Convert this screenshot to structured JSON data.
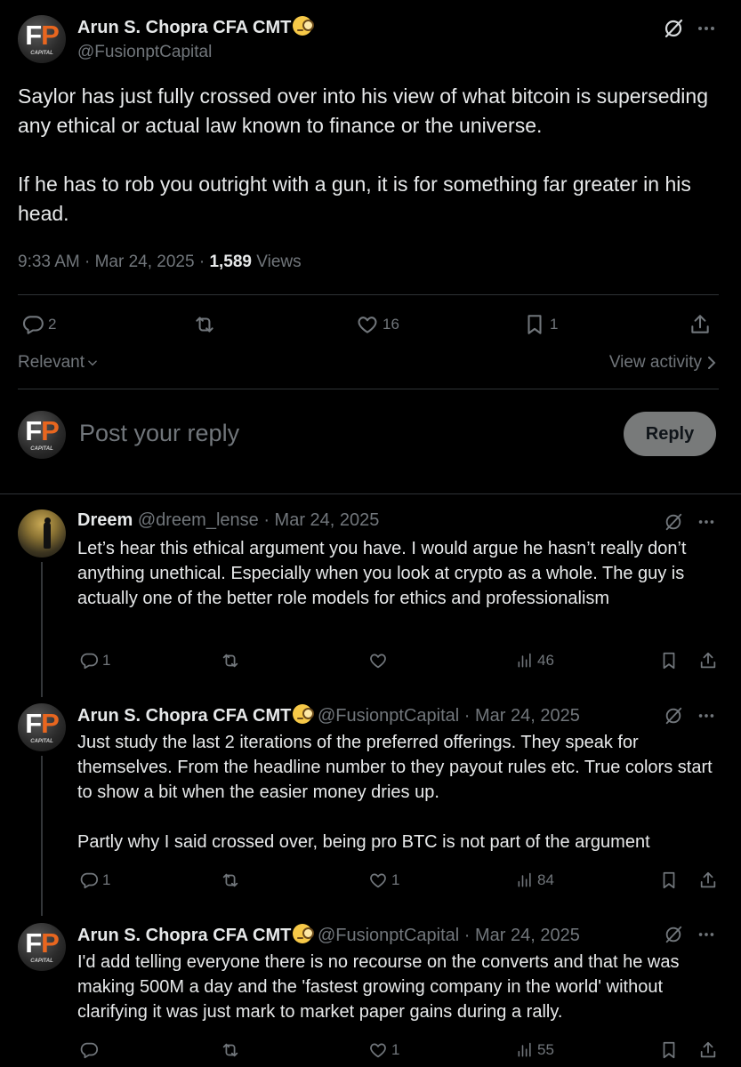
{
  "main_tweet": {
    "author_name": "Arun S. Chopra CFA CMT",
    "author_handle": "@FusionptCapital",
    "avatar_letters_f": "F",
    "avatar_letters_p": "P",
    "avatar_caption": "CAPITAL",
    "text": [
      "Saylor has just fully crossed over into his view of what bitcoin is superseding any ethical or actual law known to finance or the universe.",
      "If he has to rob you outright with a gun, it is for something far greater in his head."
    ],
    "time": "9:33 AM · Mar 24, 2025 · ",
    "views_count": "1,589",
    "views_label": " Views",
    "actions": {
      "replies": "2",
      "reposts": "",
      "likes": "16",
      "bookmarks": "1"
    }
  },
  "sort": {
    "relevant_label": "Relevant",
    "view_activity_label": "View activity"
  },
  "composer": {
    "placeholder": "Post your reply",
    "reply_button": "Reply"
  },
  "replies": [
    {
      "author_name": "Dreem",
      "meta": "@dreem_lense · Mar 24, 2025",
      "text": [
        "Let’s hear this ethical argument you have. I would argue he hasn’t really don’t anything unethical. Especially when you look at crypto as a whole. The guy is actually one of the better role models for ethics and professionalism"
      ],
      "replies": "1",
      "likes": "",
      "views": "46"
    },
    {
      "author_name": "Arun S. Chopra CFA CMT",
      "meta": "@FusionptCapital · Mar 24, 2025",
      "text": [
        "Just study the last 2 iterations of the preferred offerings. They speak for themselves. From the headline number to they payout rules etc. True colors start to show a bit when the easier money dries up.",
        "Partly why I said crossed over, being pro BTC is not part of the argument"
      ],
      "replies": "1",
      "likes": "1",
      "views": "84"
    },
    {
      "author_name": "Arun S. Chopra CFA CMT",
      "meta": "@FusionptCapital · Mar 24, 2025",
      "text": [
        "I'd add telling everyone there is no recourse on the converts and that he was making 500M a day and the 'fastest growing company in the world' without clarifying it was just mark to market paper gains during a rally."
      ],
      "replies": "",
      "likes": "1",
      "views": "55"
    }
  ],
  "icons": {
    "grok": "grok-slash-circle-icon",
    "more": "more-dots-icon",
    "reply": "speech-bubble-icon",
    "repost": "repost-arrows-icon",
    "like": "heart-icon",
    "bookmark": "bookmark-icon",
    "share": "share-upload-icon",
    "views": "bar-chart-icon"
  }
}
